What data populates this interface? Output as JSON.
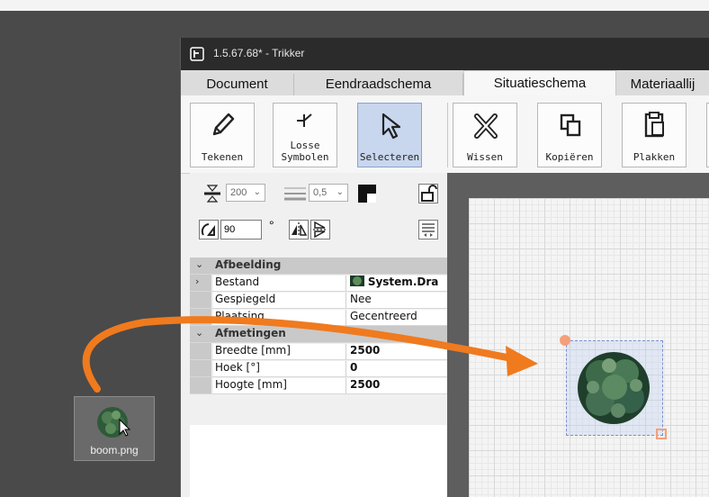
{
  "window": {
    "title": "1.5.67.68* - Trikker"
  },
  "tabs": [
    {
      "label": "Document"
    },
    {
      "label": "Eendraadschema"
    },
    {
      "label": "Situatieschema"
    },
    {
      "label": "Materiaallij"
    }
  ],
  "ribbon": {
    "tekenen": "Tekenen",
    "losse_line1": "Losse",
    "losse_line2": "Symbolen",
    "selecteren": "Selecteren",
    "wissen": "Wissen",
    "kopieren": "Kopiëren",
    "plakken": "Plakken"
  },
  "toolbar": {
    "line_size": "200",
    "line_width": "0,5",
    "rotation": "90",
    "degree_symbol": "°"
  },
  "properties": {
    "afbeelding": "Afbeelding",
    "bestand_label": "Bestand",
    "bestand_value": "System.Dra",
    "gespiegeld_label": "Gespiegeld",
    "gespiegeld_value": "Nee",
    "plaatsing_label": "Plaatsing",
    "plaatsing_value": "Gecentreerd",
    "afmetingen": "Afmetingen",
    "breedte_label": "Breedte [mm]",
    "breedte_value": "2500",
    "hoek_label": "Hoek [°]",
    "hoek_value": "0",
    "hoogte_label": "Hoogte [mm]",
    "hoogte_value": "2500"
  },
  "desktop": {
    "file_name": "boom.png"
  },
  "colors": {
    "arrow": "#f07a1e",
    "selected_tab": "#f7f7f7",
    "selected_button": "#c8d6ee"
  }
}
